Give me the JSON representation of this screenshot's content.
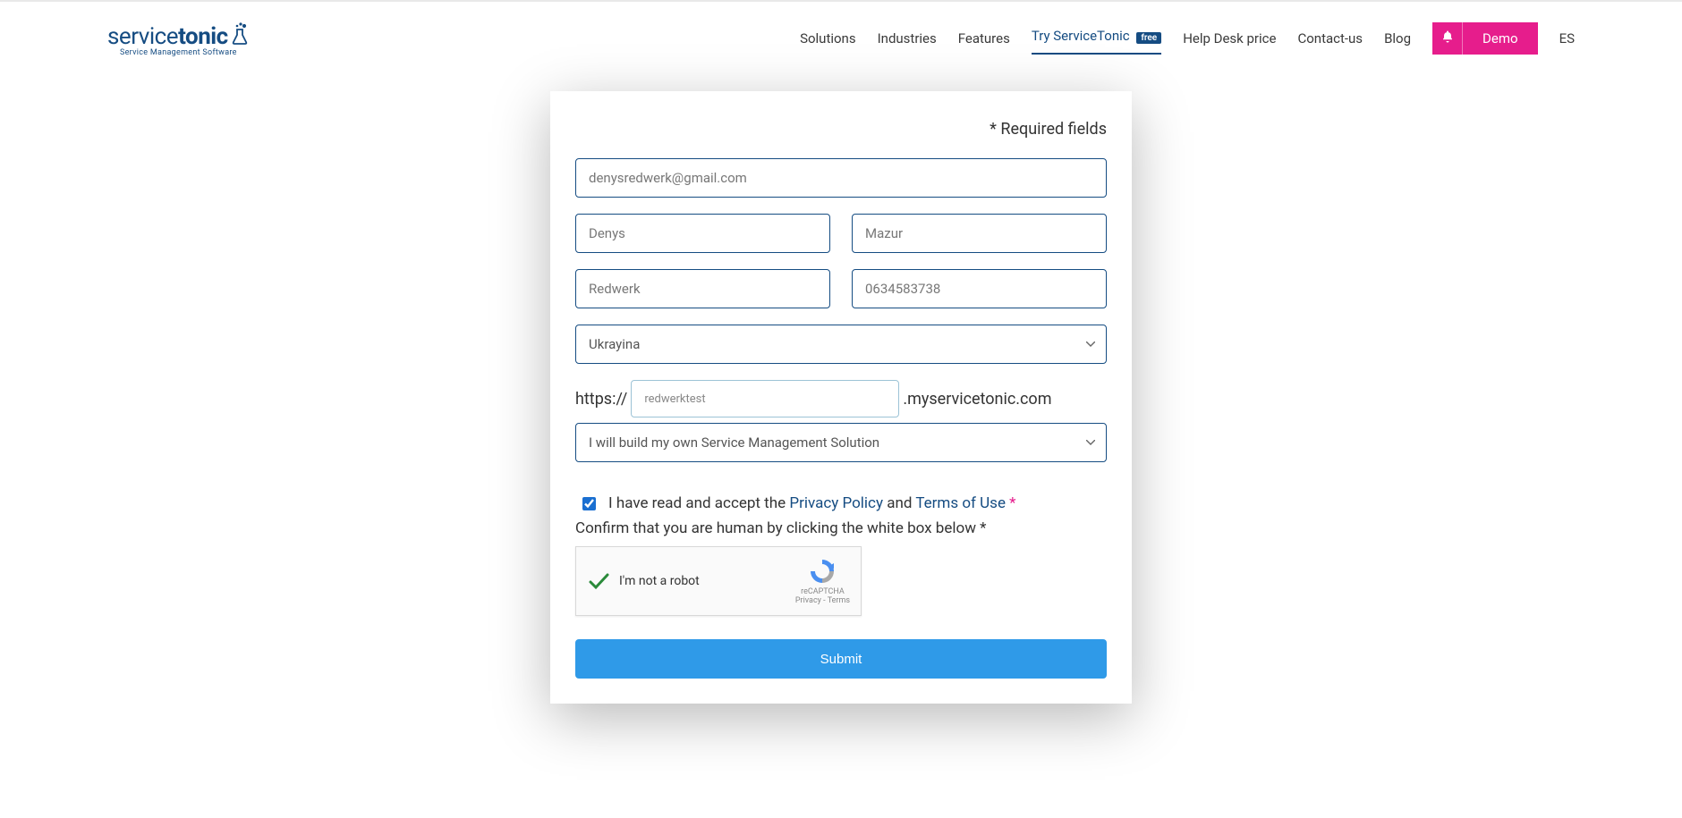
{
  "brand": {
    "name_part1": "service",
    "name_part2": "tonic",
    "tagline": "Service Management Software"
  },
  "nav": {
    "solutions": "Solutions",
    "industries": "Industries",
    "features": "Features",
    "try": "Try ServiceTonic",
    "try_badge": "free",
    "helpdesk": "Help Desk price",
    "contact": "Contact-us",
    "blog": "Blog",
    "demo": "Demo",
    "lang": "ES"
  },
  "form": {
    "required_note": "* Required fields",
    "email": "denysredwerk@gmail.com",
    "first_name": "Denys",
    "last_name": "Mazur",
    "company": "Redwerk",
    "phone": "0634583738",
    "country": "Ukrayina",
    "url_proto": "https://",
    "subdomain": "redwerktest",
    "url_domain": ".myservicetonic.com",
    "solution": "I will build my own Service Management Solution",
    "consent_pre": "I have read and accept the ",
    "privacy": "Privacy Policy",
    "consent_and": " and ",
    "terms": "Terms of Use",
    "consent_star": " *",
    "captcha_note": "Confirm that you are human by clicking the white box below *",
    "recaptcha_label": "I'm not a robot",
    "recaptcha_brand": "reCAPTCHA",
    "recaptcha_links": "Privacy - Terms",
    "submit": "Submit"
  },
  "colors": {
    "brand_blue": "#154c82",
    "accent_pink": "#e61d8c",
    "submit_blue": "#2f9ae8"
  }
}
